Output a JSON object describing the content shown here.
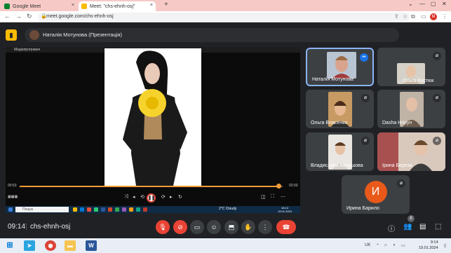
{
  "browser": {
    "tabs": [
      {
        "title": "Google Meet",
        "close": "×"
      },
      {
        "title": "Meet: \"chs-ehnh-osj\"",
        "close": "×"
      }
    ],
    "new_tab": "+",
    "url": "meet.google.com/chs-ehnh-osj",
    "profile_initial": "M"
  },
  "meet": {
    "presenter_title": "Наталія Мотунова (Презентація)",
    "player_title": "Медіапрогравач",
    "time_start": "00:53",
    "time_end": "02:03",
    "inner_search_placeholder": "Пошук",
    "inner_weather": "2°C Cloudy",
    "inner_clock": [
      "16:13",
      "19.01.2024"
    ],
    "participants": [
      {
        "name": "Наталія Мотунова",
        "speaking": true
      },
      {
        "name": "Ольга Костюк"
      },
      {
        "name": "Ольга Власенко"
      },
      {
        "name": "Dasha Hripyn"
      },
      {
        "name": "Владислава Калашова"
      },
      {
        "name": "Ірина Береза"
      },
      {
        "name": "Ирина Барило",
        "initial": "И"
      }
    ],
    "bottom": {
      "time": "09:14",
      "separator": "|",
      "code": "chs-ehnh-osj",
      "people_count": "8"
    }
  },
  "taskbar": {
    "lang": "UK",
    "clock_time": "9:14",
    "clock_date": "19.01.2024"
  }
}
